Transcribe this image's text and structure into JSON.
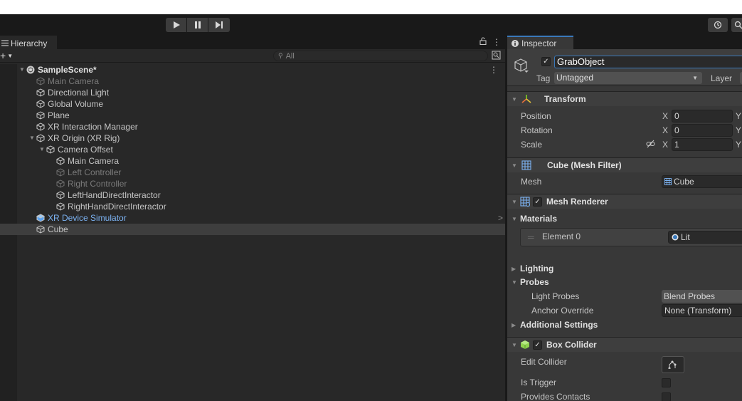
{
  "toolbar": {
    "play_icon": "play-icon",
    "pause_icon": "pause-icon",
    "step_icon": "step-icon",
    "history_icon": "history-icon"
  },
  "hierarchy": {
    "tab_label": "Hierarchy",
    "search_placeholder": "All",
    "tree": [
      {
        "label": "SampleScene*",
        "kind": "scene",
        "depth": 0,
        "expanded": true
      },
      {
        "label": "Main Camera",
        "kind": "disabled",
        "depth": 1
      },
      {
        "label": "Directional Light",
        "kind": "normal",
        "depth": 1
      },
      {
        "label": "Global Volume",
        "kind": "normal",
        "depth": 1
      },
      {
        "label": "Plane",
        "kind": "normal",
        "depth": 1
      },
      {
        "label": "XR Interaction Manager",
        "kind": "normal",
        "depth": 1
      },
      {
        "label": "XR Origin (XR Rig)",
        "kind": "normal",
        "depth": 1,
        "expanded": true
      },
      {
        "label": "Camera Offset",
        "kind": "normal",
        "depth": 2,
        "expanded": true
      },
      {
        "label": "Main Camera",
        "kind": "normal",
        "depth": 3
      },
      {
        "label": "Left Controller",
        "kind": "disabled",
        "depth": 3
      },
      {
        "label": "Right Controller",
        "kind": "disabled",
        "depth": 3
      },
      {
        "label": "LeftHandDirectInteractor",
        "kind": "normal",
        "depth": 3
      },
      {
        "label": "RightHandDirectInteractor",
        "kind": "normal",
        "depth": 3
      },
      {
        "label": "XR Device Simulator",
        "kind": "prefab",
        "depth": 1
      },
      {
        "label": "Cube",
        "kind": "normal",
        "depth": 1,
        "selected": true
      }
    ]
  },
  "inspector": {
    "tab_label": "Inspector",
    "object_name": "GrabObject",
    "tag_label": "Tag",
    "tag_value": "Untagged",
    "layer_label": "Layer",
    "transform": {
      "title": "Transform",
      "position_label": "Position",
      "rotation_label": "Rotation",
      "scale_label": "Scale",
      "x_label": "X",
      "y_label": "Y",
      "position_x": "0",
      "rotation_x": "0",
      "scale_x": "1"
    },
    "mesh_filter": {
      "title": "Cube (Mesh Filter)",
      "mesh_label": "Mesh",
      "mesh_value": "Cube"
    },
    "mesh_renderer": {
      "title": "Mesh Renderer",
      "materials_label": "Materials",
      "element_label": "Element 0",
      "element_value": "Lit",
      "lighting_label": "Lighting",
      "probes_label": "Probes",
      "light_probes_label": "Light Probes",
      "light_probes_value": "Blend Probes",
      "anchor_label": "Anchor Override",
      "anchor_value": "None (Transform)",
      "additional_label": "Additional Settings"
    },
    "box_collider": {
      "title": "Box Collider",
      "edit_label": "Edit Collider",
      "trigger_label": "Is Trigger",
      "contacts_label": "Provides Contacts"
    }
  },
  "colors": {
    "accent": "#3a79bb",
    "prefab_text": "#7cb3f3",
    "transform_icon_green": "#7ed321",
    "collider_icon_green": "#8fd14f"
  }
}
